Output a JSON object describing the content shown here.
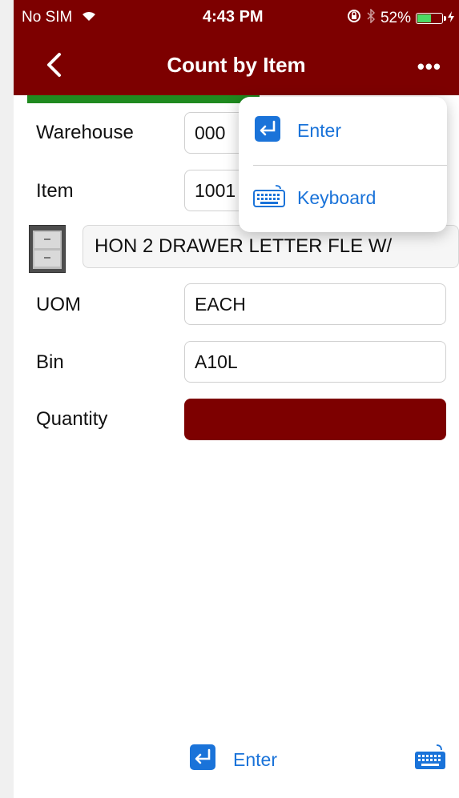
{
  "status_bar": {
    "carrier": "No SIM",
    "time": "4:43 PM",
    "battery_percent": "52%",
    "battery_level": 0.52
  },
  "nav": {
    "title": "Count by Item",
    "more_label": "•••"
  },
  "form": {
    "warehouse_label": "Warehouse",
    "warehouse_value": "000",
    "item_label": "Item",
    "item_value": "1001",
    "description": "HON 2 DRAWER LETTER FLE W/",
    "uom_label": "UOM",
    "uom_value": "EACH",
    "bin_label": "Bin",
    "bin_value": "A10L",
    "quantity_label": "Quantity",
    "quantity_value": ""
  },
  "popover": {
    "items": [
      {
        "label": "Enter",
        "icon": "enter-icon"
      },
      {
        "label": "Keyboard",
        "icon": "keyboard-icon"
      }
    ]
  },
  "bottom_bar": {
    "enter_label": "Enter",
    "keyboard_icon": "keyboard-icon"
  },
  "colors": {
    "brand": "#7d0000",
    "accent": "#1a73d9",
    "success": "#1f8a1f"
  }
}
